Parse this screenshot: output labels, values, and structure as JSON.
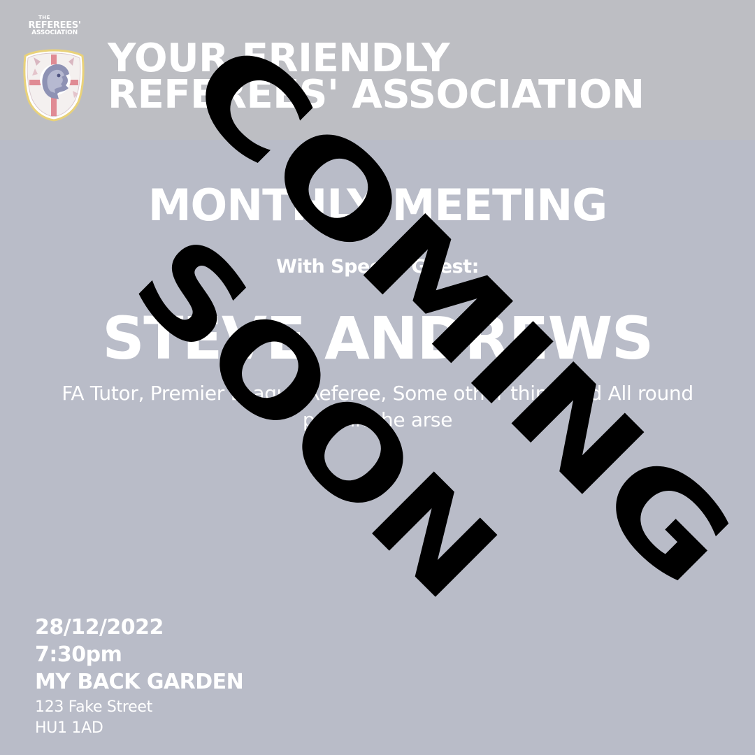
{
  "logo": {
    "the": "THE",
    "referees": "REFEREES'",
    "association": "ASSOCIATION"
  },
  "header": {
    "title_line1": "YOUR FRIENDLY",
    "title_line2": "REFEREES' ASSOCIATION"
  },
  "event": {
    "title": "MONTHLY MEETING",
    "special_guest_label": "With Special Guest:",
    "guest_name": "STEVE ANDREWS",
    "guest_description": "FA Tutor, Premier League Referee, Some other thing and All round pain in the arse"
  },
  "details": {
    "date": "28/12/2022",
    "time": "7:30pm",
    "venue": "MY BACK GARDEN",
    "address_line1": "123 Fake Street",
    "address_line2": "HU1 1AD"
  },
  "overlay": {
    "line1": "COMING",
    "line2": "SOON"
  },
  "colors": {
    "header_bg": "#bdbec3",
    "body_bg": "#b9bcc8",
    "text": "#ffffff",
    "stamp": "#000000",
    "shield_red": "#c8323c",
    "shield_navy": "#2f3568"
  }
}
